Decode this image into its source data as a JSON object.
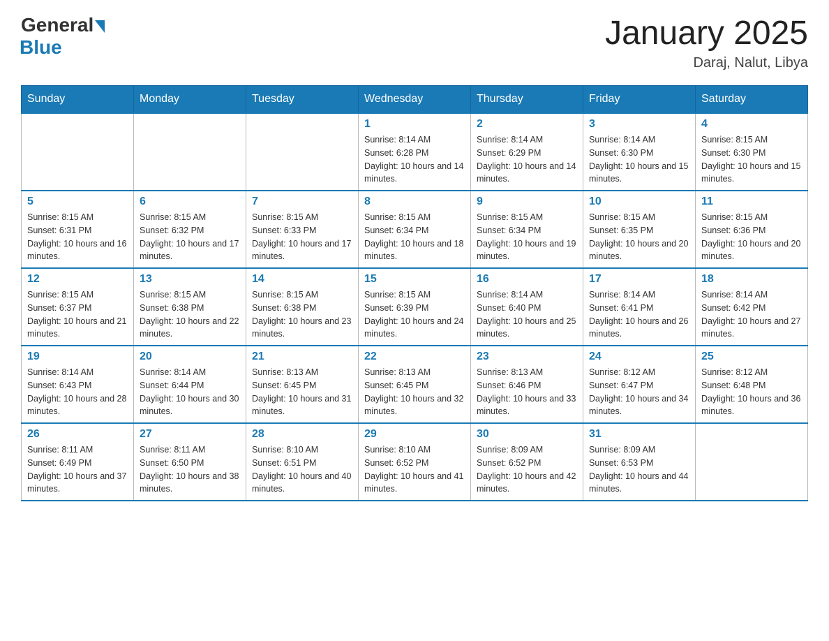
{
  "header": {
    "logo_general": "General",
    "logo_blue": "Blue",
    "month_title": "January 2025",
    "location": "Daraj, Nalut, Libya"
  },
  "days_of_week": [
    "Sunday",
    "Monday",
    "Tuesday",
    "Wednesday",
    "Thursday",
    "Friday",
    "Saturday"
  ],
  "weeks": [
    [
      {
        "day": "",
        "info": ""
      },
      {
        "day": "",
        "info": ""
      },
      {
        "day": "",
        "info": ""
      },
      {
        "day": "1",
        "info": "Sunrise: 8:14 AM\nSunset: 6:28 PM\nDaylight: 10 hours and 14 minutes."
      },
      {
        "day": "2",
        "info": "Sunrise: 8:14 AM\nSunset: 6:29 PM\nDaylight: 10 hours and 14 minutes."
      },
      {
        "day": "3",
        "info": "Sunrise: 8:14 AM\nSunset: 6:30 PM\nDaylight: 10 hours and 15 minutes."
      },
      {
        "day": "4",
        "info": "Sunrise: 8:15 AM\nSunset: 6:30 PM\nDaylight: 10 hours and 15 minutes."
      }
    ],
    [
      {
        "day": "5",
        "info": "Sunrise: 8:15 AM\nSunset: 6:31 PM\nDaylight: 10 hours and 16 minutes."
      },
      {
        "day": "6",
        "info": "Sunrise: 8:15 AM\nSunset: 6:32 PM\nDaylight: 10 hours and 17 minutes."
      },
      {
        "day": "7",
        "info": "Sunrise: 8:15 AM\nSunset: 6:33 PM\nDaylight: 10 hours and 17 minutes."
      },
      {
        "day": "8",
        "info": "Sunrise: 8:15 AM\nSunset: 6:34 PM\nDaylight: 10 hours and 18 minutes."
      },
      {
        "day": "9",
        "info": "Sunrise: 8:15 AM\nSunset: 6:34 PM\nDaylight: 10 hours and 19 minutes."
      },
      {
        "day": "10",
        "info": "Sunrise: 8:15 AM\nSunset: 6:35 PM\nDaylight: 10 hours and 20 minutes."
      },
      {
        "day": "11",
        "info": "Sunrise: 8:15 AM\nSunset: 6:36 PM\nDaylight: 10 hours and 20 minutes."
      }
    ],
    [
      {
        "day": "12",
        "info": "Sunrise: 8:15 AM\nSunset: 6:37 PM\nDaylight: 10 hours and 21 minutes."
      },
      {
        "day": "13",
        "info": "Sunrise: 8:15 AM\nSunset: 6:38 PM\nDaylight: 10 hours and 22 minutes."
      },
      {
        "day": "14",
        "info": "Sunrise: 8:15 AM\nSunset: 6:38 PM\nDaylight: 10 hours and 23 minutes."
      },
      {
        "day": "15",
        "info": "Sunrise: 8:15 AM\nSunset: 6:39 PM\nDaylight: 10 hours and 24 minutes."
      },
      {
        "day": "16",
        "info": "Sunrise: 8:14 AM\nSunset: 6:40 PM\nDaylight: 10 hours and 25 minutes."
      },
      {
        "day": "17",
        "info": "Sunrise: 8:14 AM\nSunset: 6:41 PM\nDaylight: 10 hours and 26 minutes."
      },
      {
        "day": "18",
        "info": "Sunrise: 8:14 AM\nSunset: 6:42 PM\nDaylight: 10 hours and 27 minutes."
      }
    ],
    [
      {
        "day": "19",
        "info": "Sunrise: 8:14 AM\nSunset: 6:43 PM\nDaylight: 10 hours and 28 minutes."
      },
      {
        "day": "20",
        "info": "Sunrise: 8:14 AM\nSunset: 6:44 PM\nDaylight: 10 hours and 30 minutes."
      },
      {
        "day": "21",
        "info": "Sunrise: 8:13 AM\nSunset: 6:45 PM\nDaylight: 10 hours and 31 minutes."
      },
      {
        "day": "22",
        "info": "Sunrise: 8:13 AM\nSunset: 6:45 PM\nDaylight: 10 hours and 32 minutes."
      },
      {
        "day": "23",
        "info": "Sunrise: 8:13 AM\nSunset: 6:46 PM\nDaylight: 10 hours and 33 minutes."
      },
      {
        "day": "24",
        "info": "Sunrise: 8:12 AM\nSunset: 6:47 PM\nDaylight: 10 hours and 34 minutes."
      },
      {
        "day": "25",
        "info": "Sunrise: 8:12 AM\nSunset: 6:48 PM\nDaylight: 10 hours and 36 minutes."
      }
    ],
    [
      {
        "day": "26",
        "info": "Sunrise: 8:11 AM\nSunset: 6:49 PM\nDaylight: 10 hours and 37 minutes."
      },
      {
        "day": "27",
        "info": "Sunrise: 8:11 AM\nSunset: 6:50 PM\nDaylight: 10 hours and 38 minutes."
      },
      {
        "day": "28",
        "info": "Sunrise: 8:10 AM\nSunset: 6:51 PM\nDaylight: 10 hours and 40 minutes."
      },
      {
        "day": "29",
        "info": "Sunrise: 8:10 AM\nSunset: 6:52 PM\nDaylight: 10 hours and 41 minutes."
      },
      {
        "day": "30",
        "info": "Sunrise: 8:09 AM\nSunset: 6:52 PM\nDaylight: 10 hours and 42 minutes."
      },
      {
        "day": "31",
        "info": "Sunrise: 8:09 AM\nSunset: 6:53 PM\nDaylight: 10 hours and 44 minutes."
      },
      {
        "day": "",
        "info": ""
      }
    ]
  ]
}
